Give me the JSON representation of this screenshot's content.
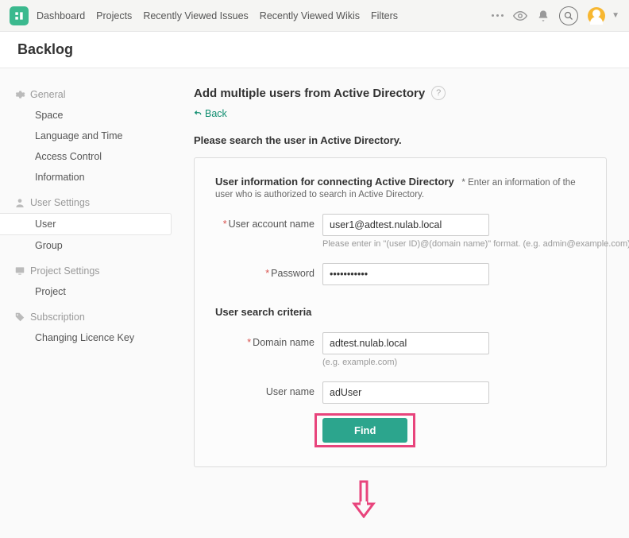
{
  "topnav": {
    "items": [
      "Dashboard",
      "Projects",
      "Recently Viewed Issues",
      "Recently Viewed Wikis",
      "Filters"
    ]
  },
  "page_title": "Backlog",
  "sidebar": {
    "groups": [
      {
        "title": "General",
        "icon": "gear",
        "items": [
          "Space",
          "Language and Time",
          "Access Control",
          "Information"
        ]
      },
      {
        "title": "User Settings",
        "icon": "user",
        "items": [
          "User",
          "Group"
        ],
        "active_index": 0
      },
      {
        "title": "Project Settings",
        "icon": "screen",
        "items": [
          "Project"
        ]
      },
      {
        "title": "Subscription",
        "icon": "tag",
        "items": [
          "Changing Licence Key"
        ]
      }
    ]
  },
  "main": {
    "heading": "Add multiple users from Active Directory",
    "back_label": "Back",
    "instruction": "Please search the user in Active Directory.",
    "section1": {
      "title": "User information for connecting Active Directory",
      "note_asterisk": "*",
      "note": "Enter an information of the user who is authorized to search in Active Directory."
    },
    "fields": {
      "account_label": "User account name",
      "account_value": "user1@adtest.nulab.local",
      "account_hint": "Please enter in \"(user ID)@(domain name)\" format. (e.g. admin@example.com)",
      "password_label": "Password",
      "password_value": "•••••••••••"
    },
    "section2": {
      "title": "User search criteria"
    },
    "search": {
      "domain_label": "Domain name",
      "domain_value": "adtest.nulab.local",
      "domain_hint": "(e.g. example.com)",
      "username_label": "User name",
      "username_value": "adUser"
    },
    "find_label": "Find"
  },
  "colors": {
    "accent": "#2ca58d",
    "highlight": "#e8447c"
  }
}
